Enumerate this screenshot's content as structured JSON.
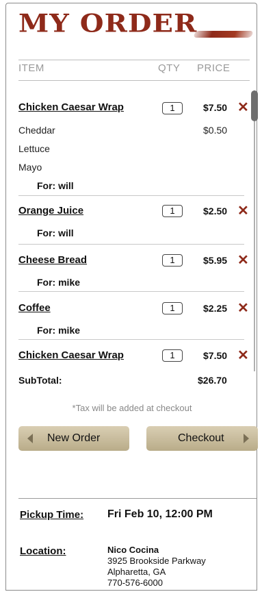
{
  "header": {
    "title": "MY ORDER"
  },
  "columns": {
    "item": "ITEM",
    "qty": "QTY",
    "price": "PRICE"
  },
  "items": [
    {
      "name": "Chicken Caesar Wrap",
      "qty": "1",
      "price": "$7.50",
      "mods": [
        {
          "label": "Cheddar",
          "price": "$0.50"
        },
        {
          "label": "Lettuce",
          "price": ""
        },
        {
          "label": "Mayo",
          "price": ""
        }
      ],
      "for": "For: will"
    },
    {
      "name": "Orange Juice",
      "qty": "1",
      "price": "$2.50",
      "for": "For: will"
    },
    {
      "name": "Cheese Bread",
      "qty": "1",
      "price": "$5.95",
      "for": "For: mike"
    },
    {
      "name": "Coffee",
      "qty": "1",
      "price": "$2.25",
      "for": "For: mike"
    },
    {
      "name": "Chicken Caesar Wrap",
      "qty": "1",
      "price": "$7.50"
    }
  ],
  "subtotal": {
    "label": "SubTotal:",
    "value": "$26.70"
  },
  "tax_note": "*Tax will be added at checkout",
  "buttons": {
    "new_order": "New Order",
    "checkout": "Checkout"
  },
  "pickup": {
    "label": "Pickup Time:",
    "value": "Fri Feb 10, 12:00 PM"
  },
  "location": {
    "label": "Location:",
    "name": "Nico Cocina",
    "line1": "3925 Brookside Parkway",
    "line2": "Alpharetta, GA",
    "phone": "770-576-6000"
  },
  "colors": {
    "accent": "#8e2a1a",
    "button": "#c8bc9c"
  },
  "icons": {
    "remove": "remove-x-icon",
    "left": "arrow-left-icon",
    "right": "arrow-right-icon"
  }
}
